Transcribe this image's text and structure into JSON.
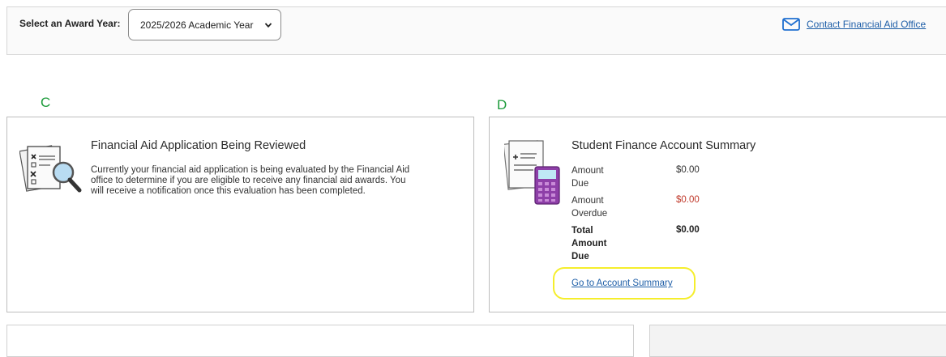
{
  "award_year": {
    "label": "Select an Award Year:",
    "selected": "2025/2026 Academic Year"
  },
  "contact": {
    "label": "Contact Financial Aid Office",
    "icon": "envelope-icon",
    "color": "#1f5fa8"
  },
  "markers": {
    "left": "C",
    "right": "D",
    "color": "#1c9b3a"
  },
  "aid_card": {
    "title": "Financial Aid Application Being Reviewed",
    "body_lines": [
      "Currently your financial aid application is being evaluated by the Financial Aid",
      "office to determine if you are eligible to receive any financial aid awards. You",
      "will receive a notification once this evaluation has been completed."
    ],
    "icon": "document-magnifier-icon"
  },
  "finance_card": {
    "title": "Student Finance Account Summary",
    "icon": "calculator-document-icon",
    "rows": [
      {
        "label_lines": [
          "Amount",
          "Due"
        ],
        "value": "$0.00"
      },
      {
        "label_lines": [
          "Amount",
          "Overdue"
        ],
        "value": "$0.00"
      },
      {
        "label_lines": [
          "Total",
          "Amount",
          "Due"
        ],
        "value": "$0.00"
      }
    ],
    "link": "Go to Account Summary",
    "highlight_color": "#f5ee2c",
    "overdue_color": "#c0392b"
  }
}
